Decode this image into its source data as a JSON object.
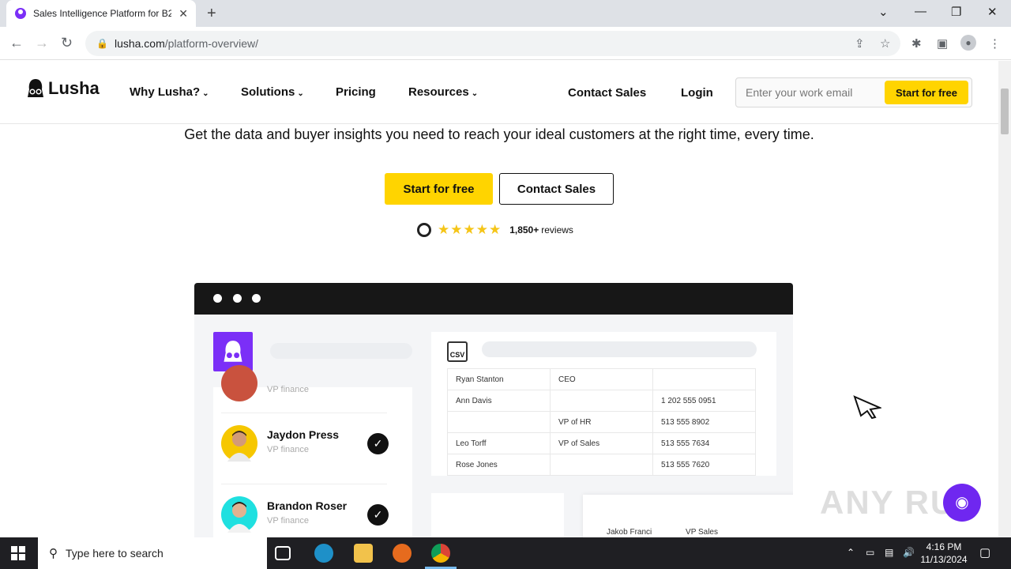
{
  "browser": {
    "tab_title": "Sales Intelligence Platform for B2",
    "url_domain": "lusha.com",
    "url_path": "/platform-overview/"
  },
  "site": {
    "logo_text": "Lusha",
    "nav": {
      "why": "Why Lusha?",
      "solutions": "Solutions",
      "pricing": "Pricing",
      "resources": "Resources",
      "contact": "Contact Sales",
      "login": "Login"
    },
    "email_placeholder": "Enter your work email",
    "email_cta": "Start for free"
  },
  "hero": {
    "subtitle": "Get the data and buyer insights you need to reach your ideal customers at the right time, every time.",
    "primary_cta": "Start for free",
    "secondary_cta": "Contact Sales",
    "rating_stars": 4.5,
    "reviews_count": "1,850+",
    "reviews_label": "reviews"
  },
  "mock": {
    "people": [
      {
        "name": "",
        "role": "VP finance"
      },
      {
        "name": "Jaydon Press",
        "role": "VP finance"
      },
      {
        "name": "Brandon Roser",
        "role": "VP finance"
      }
    ],
    "csv_label": "CSV",
    "table": [
      [
        "Ryan Stanton",
        "CEO",
        ""
      ],
      [
        "Ann Davis",
        "",
        "1 202 555 0951"
      ],
      [
        "",
        "VP of HR",
        "513 555 8902"
      ],
      [
        "Leo Torff",
        "VP of Sales",
        "513 555 7634"
      ],
      [
        "Rose Jones",
        "",
        "513 555 7620"
      ]
    ],
    "bottom_row": {
      "name": "Jakob Franci",
      "role": "VP Sales"
    }
  },
  "watermark": "ANY RUN",
  "taskbar": {
    "search_placeholder": "Type here to search",
    "time": "4:16 PM",
    "date": "11/13/2024"
  },
  "colors": {
    "brand_yellow": "#ffd400",
    "brand_purple": "#7b2ff7"
  }
}
